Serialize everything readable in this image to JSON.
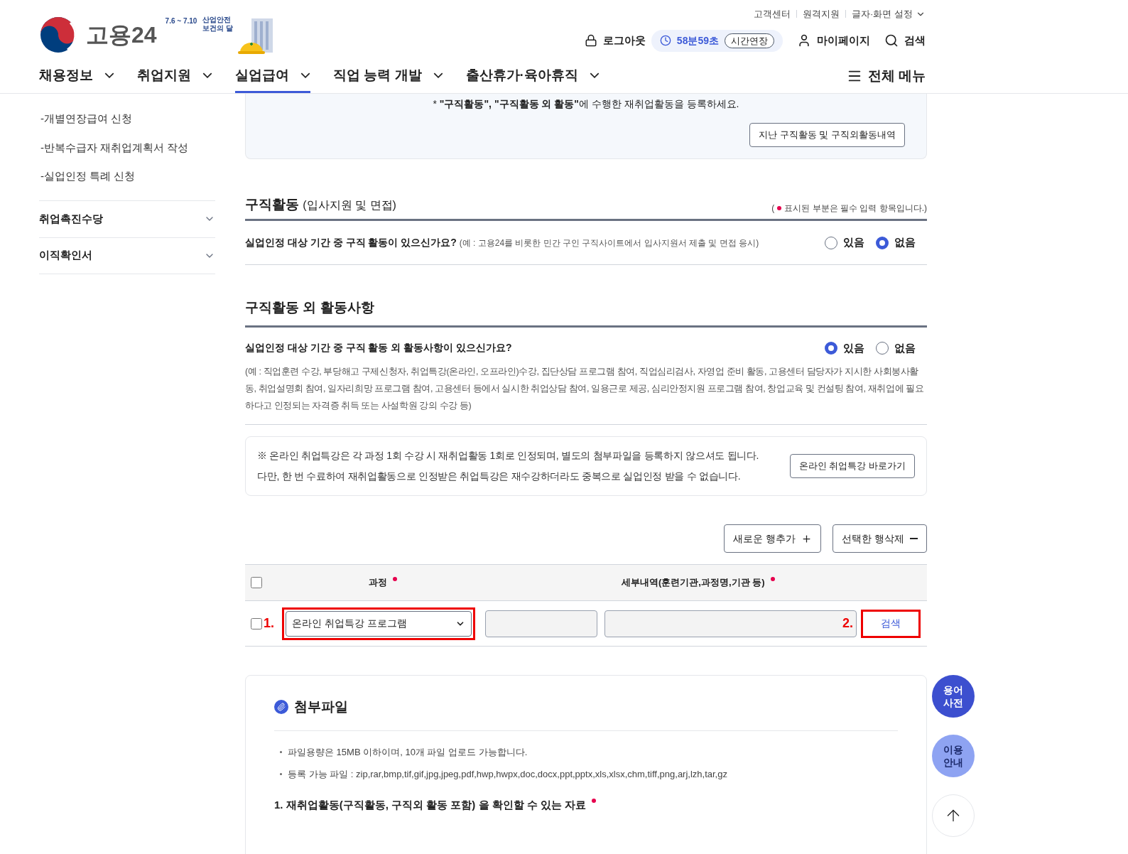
{
  "header": {
    "util_links": [
      "고객센터",
      "원격지원",
      "글자·화면 설정"
    ],
    "logo": {
      "name": "고용24",
      "event_dates": "7.6 ~ 7.10",
      "event_title": "산업안전\n보건의 달"
    },
    "logout": "로그아웃",
    "timer": "58분59초",
    "extend": "시간연장",
    "mypage": "마이페이지",
    "search": "검색",
    "nav": [
      {
        "label": "채용정보",
        "selected": false
      },
      {
        "label": "취업지원",
        "selected": false
      },
      {
        "label": "실업급여",
        "selected": true
      },
      {
        "label": "직업 능력 개발",
        "selected": false
      },
      {
        "label": "출산휴가·육아휴직",
        "selected": false
      }
    ],
    "all_menu": "전체 메뉴"
  },
  "sidebar": {
    "sub_items": [
      "-개별연장급여 신청",
      "-반복수급자 재취업계획서 작성",
      "-실업인정 특례 신청"
    ],
    "groups": [
      {
        "label": "취업촉진수당",
        "expanded": false
      },
      {
        "label": "이직확인서",
        "expanded": false
      }
    ]
  },
  "notice": {
    "text": "* **\"구직활동\", \"구직활동 외 활동\"**에 수행한 재취업활동을 등록하세요.",
    "button": "지난 구직활동 및 구직외활동내역"
  },
  "job_search": {
    "title": "구직활동",
    "subtitle": "(입사지원 및 면접)",
    "required_note_pre": "(",
    "required_note": "표시된 부분은 필수 입력 항목입니다.)",
    "question": "실업인정 대상 기간 중 구직 활동이 있으신가요?",
    "example": "(예 : 고용24를 비롯한 민간 구인 구직사이트에서 입사지원서 제출 및 면접 응시)",
    "options": [
      {
        "label": "있음",
        "selected": false
      },
      {
        "label": "없음",
        "selected": true
      }
    ]
  },
  "other_activity": {
    "title": "구직활동 외 활동사항",
    "question": "실업인정 대상 기간 중 구직 활동 외 활동사항이 있으신가요?",
    "options": [
      {
        "label": "있음",
        "selected": true
      },
      {
        "label": "없음",
        "selected": false
      }
    ],
    "example": "(예 : 직업훈련 수강, 부당해고 구제신청자, 취업특강(온라인, 오프라인)수강, 집단상담 프로그램 참여, 직업심리검사, 자영업 준비 활동, 고용센터 담당자가 지시한 사회봉사활동, 취업설명회 참여, 일자리희망 프로그램 참여, 고용센터 등에서 실시한 취업상담 참여, 일용근로 제공, 심리안정지원 프로그램 참여, 창업교육 및 컨설팅 참여, 재취업에 필요하다고 인정되는 자격증 취득 또는 사설학원 강의 수강 등)",
    "info_lines": [
      "※ 온라인 취업특강은 각 과정 1회 수강 시 재취업활동 1회로 인정되며, 별도의 첨부파일을 등록하지 않으셔도 됩니다.",
      "다만, 한 번 수료하여 재취업활동으로 인정받은 취업특강은 재수강하더라도 중복으로 실업인정 받을 수 없습니다."
    ],
    "info_button": "온라인 취업특강 바로가기",
    "add_row": "새로운 행추가",
    "delete_row": "선택한 행삭제",
    "table": {
      "header_checked": false,
      "columns": [
        "과정",
        "세부내역(훈련기관,과정명,기관 등)"
      ],
      "rows": [
        {
          "checked": false,
          "course": "온라인 취업특강 프로그램",
          "search": "검색"
        }
      ]
    },
    "annotations": [
      "1.",
      "2."
    ]
  },
  "attachments": {
    "title": "첨부파일",
    "bullets": [
      "파일용량은 15MB 이하이며, 10개 파일 업로드 가능합니다.",
      "등록 가능 파일 : zip,rar,bmp,tif,gif,jpg,jpeg,pdf,hwp,hwpx,doc,docx,ppt,pptx,xls,xlsx,chm,tiff,png,arj,lzh,tar,gz"
    ],
    "section": "1. 재취업활동(구직활동, 구직외 활동 포함) 을 확인할 수 있는 자료"
  },
  "floating": {
    "glossary": "용어\n사전",
    "guide": "이용\n안내"
  }
}
